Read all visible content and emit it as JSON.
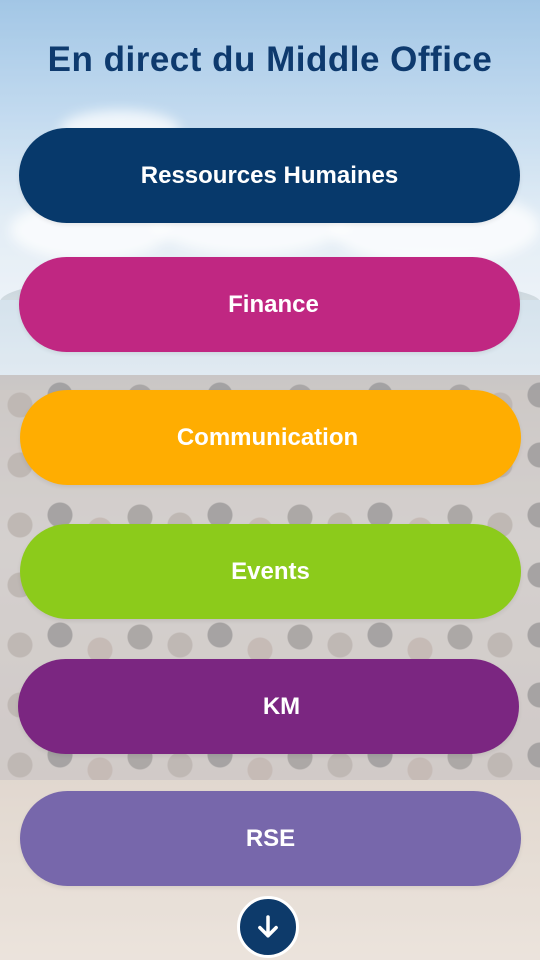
{
  "header": {
    "title": "En direct du Middle Office"
  },
  "menu": [
    {
      "id": "rh",
      "label": "Ressources Humaines",
      "color": "#07396b"
    },
    {
      "id": "finance",
      "label": "Finance",
      "color": "#c02782"
    },
    {
      "id": "communication",
      "label": "Communication",
      "color": "#ffad01"
    },
    {
      "id": "events",
      "label": "Events",
      "color": "#8ccb1b"
    },
    {
      "id": "km",
      "label": "KM",
      "color": "#7b2681"
    },
    {
      "id": "rse",
      "label": "RSE",
      "color": "#7767ab"
    }
  ],
  "colors": {
    "title": "#0e3a6e",
    "scroll_button": "#0d3a6a"
  },
  "scroll_button": {
    "icon": "arrow-down-icon"
  }
}
